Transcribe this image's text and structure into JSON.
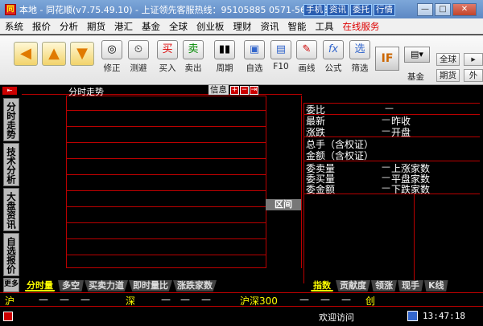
{
  "titlebar": {
    "app_icon": "同",
    "title": "本地 - 同花顺(v7.75.49.10) - 上证领先客服热线：95105885  0571-56768888",
    "buttons": [
      "手机",
      "资讯",
      "委托",
      "行情"
    ],
    "win": [
      "—",
      "□",
      "✕"
    ]
  },
  "menu": [
    "系统",
    "报价",
    "分析",
    "期货",
    "港汇",
    "基金",
    "全球",
    "创业板",
    "理财",
    "资讯",
    "智能",
    "工具"
  ],
  "menu_special": "在线服务",
  "toolbar": {
    "tools": [
      {
        "label": "修正",
        "icon": "◎"
      },
      {
        "label": "测避",
        "icon": "⏲"
      },
      {
        "label": "买入",
        "icon": "买"
      },
      {
        "label": "卖出",
        "icon": "卖"
      },
      {
        "label": "周期",
        "icon": "▮▮"
      },
      {
        "label": "自选",
        "icon": "▣"
      },
      {
        "label": "F10",
        "icon": "▤"
      },
      {
        "label": "画线",
        "icon": "✎"
      },
      {
        "label": "公式",
        "icon": "fx"
      },
      {
        "label": "筛选",
        "icon": "选"
      }
    ],
    "right": {
      "if": "IF",
      "jijin": "基金",
      "quanqiu": "全球",
      "qihuo": "期货",
      "wai": "外"
    }
  },
  "side_tabs": [
    "分时走势",
    "技术分析",
    "大盘资讯",
    "自选报价",
    "更多"
  ],
  "chart": {
    "title": "分时走势",
    "info_label": "信息"
  },
  "qujian": "区间",
  "right_panel": {
    "rows": [
      {
        "label": "委比",
        "value": "—"
      },
      {
        "label": "最新",
        "value": "—",
        "label2": "昨收"
      },
      {
        "label": "涨跌",
        "value": "—",
        "label2": "开盘"
      },
      {
        "label": "总手（含权证）"
      },
      {
        "label": "金额（含权证）"
      },
      {
        "label": "委卖量",
        "value": "—",
        "label2": "上涨家数"
      },
      {
        "label": "委买量",
        "value": "—",
        "label2": "平盘家数"
      },
      {
        "label": "委金额",
        "value": "—",
        "label2": "下跌家数"
      }
    ]
  },
  "bottom_tabs_left": [
    "分时量",
    "多空",
    "买卖力道",
    "即时量比",
    "涨跌家数"
  ],
  "bottom_tabs_right": [
    "指数",
    "贡献度",
    "领涨",
    "现手",
    "K线"
  ],
  "status": {
    "hu": "沪",
    "shen": "深",
    "husheng": "沪深300",
    "chuang": "创",
    "dash": "—"
  },
  "footer": {
    "welcome": "欢迎访问",
    "time": "13:47:18"
  }
}
